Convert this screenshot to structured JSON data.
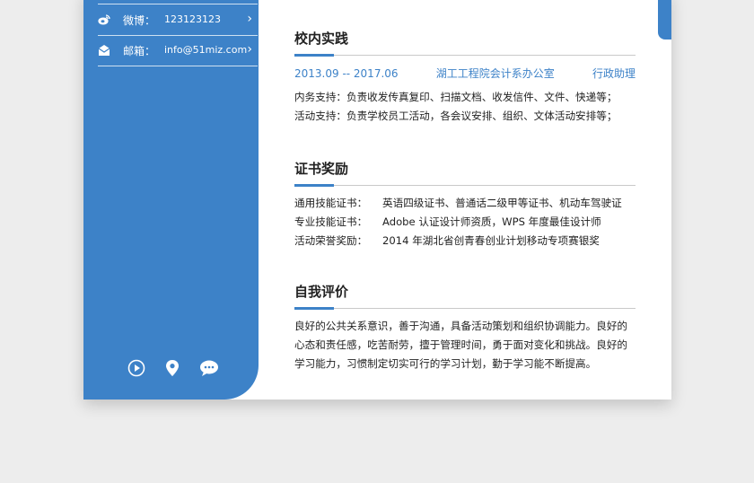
{
  "contact": {
    "weibo_label": "微博：",
    "weibo_value": "123123123",
    "email_label": "邮箱：",
    "email_value": "info@51miz.com"
  },
  "social_icons": [
    "play-icon",
    "location-icon",
    "chat-icon"
  ],
  "sections": {
    "campus": {
      "title": "校内实践",
      "period": "2013.09 -- 2017.06",
      "org": "湖工工程院会计系办公室",
      "role": "行政助理",
      "lines": [
        "内务支持：负责收发传真复印、扫描文档、收发信件、文件、快递等；",
        "活动支持：负责学校员工活动，各会议安排、组织、文体活动安排等；"
      ]
    },
    "certs": {
      "title": "证书奖励",
      "items": [
        {
          "label": "通用技能证书：",
          "value": "英语四级证书、普通话二级甲等证书、机动车驾驶证"
        },
        {
          "label": "专业技能证书：",
          "value": "Adobe 认证设计师资质，WPS 年度最佳设计师"
        },
        {
          "label": "活动荣誉奖励：",
          "value": "2014 年湖北省创青春创业计划移动专项赛银奖"
        }
      ]
    },
    "self": {
      "title": "自我评价",
      "text": "良好的公共关系意识，善于沟通，具备活动策划和组织协调能力。良好的心态和责任感，吃苦耐劳，擅于管理时间，勇于面对变化和挑战。良好的学习能力，习惯制定切实可行的学习计划，勤于学习能不断提高。"
    }
  },
  "colors": {
    "accent": "#3d82c8",
    "background": "#ededed"
  }
}
